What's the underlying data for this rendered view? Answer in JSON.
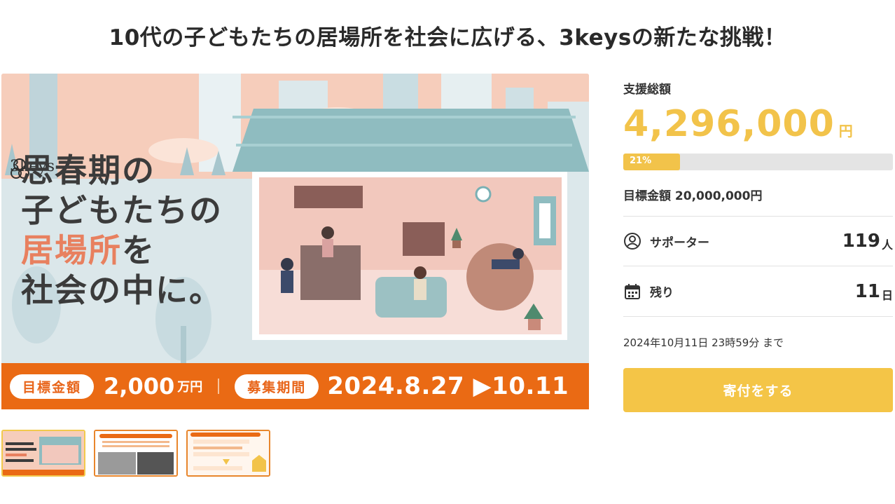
{
  "page": {
    "title": "10代の子どもたちの居場所を社会に広げる、3keysの新たな挑戦！"
  },
  "hero": {
    "brand": "3keys",
    "headline_line1": "思春期の",
    "headline_line2": "子どもたちの",
    "headline_accent": "居場所",
    "headline_line3_suffix": "を",
    "headline_line4": "社会の中に。",
    "band_goal_label": "目標金額",
    "band_goal_amount": "2,000",
    "band_goal_unit": "万円",
    "band_period_label": "募集期間",
    "band_period": "2024.8.27 ▶10.11",
    "colors": {
      "accent_orange": "#ea6a14",
      "sky": "#f6cdbb",
      "roof": "#8fbcc0"
    }
  },
  "thumbnails": [
    {
      "name": "thumb-1",
      "active": true
    },
    {
      "name": "thumb-2",
      "active": false
    },
    {
      "name": "thumb-3",
      "active": false
    }
  ],
  "panel": {
    "total_label": "支援総額",
    "total_amount": "4,296,000",
    "total_unit": "円",
    "progress_percent": 21,
    "progress_label": "21%",
    "goal_text": "目標金額 20,000,000円",
    "supporters_label": "サポーター",
    "supporters_value": "119",
    "supporters_unit": "人",
    "remaining_label": "残り",
    "remaining_value": "11",
    "remaining_unit": "日",
    "deadline": "2024年10月11日 23時59分 まで",
    "donate_button": "寄付をする",
    "colors": {
      "yellow": "#f2c34a",
      "button": "#f4c547"
    }
  }
}
